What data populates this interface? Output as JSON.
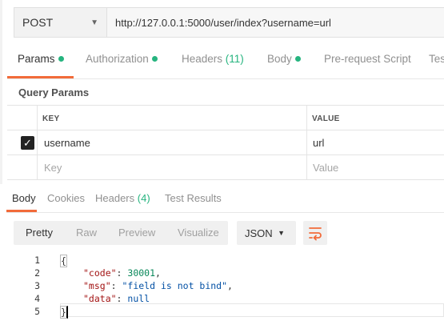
{
  "request": {
    "method": "POST",
    "url": "http://127.0.0.1:5000/user/index?username=url"
  },
  "request_tabs": [
    {
      "label": "Params",
      "dot": true
    },
    {
      "label": "Authorization",
      "dot": true
    },
    {
      "label": "Headers",
      "count": "(11)"
    },
    {
      "label": "Body",
      "dot": true
    },
    {
      "label": "Pre-request Script"
    },
    {
      "label": "Tes"
    }
  ],
  "query_params": {
    "title": "Query Params",
    "headers": {
      "key": "KEY",
      "value": "VALUE"
    },
    "rows": [
      {
        "key": "username",
        "value": "url",
        "checked": true
      }
    ],
    "placeholder_key": "Key",
    "placeholder_value": "Value"
  },
  "response_tabs": [
    {
      "label": "Body"
    },
    {
      "label": "Cookies"
    },
    {
      "label": "Headers",
      "count": "(4)"
    },
    {
      "label": "Test Results"
    }
  ],
  "view_modes": [
    "Pretty",
    "Raw",
    "Preview",
    "Visualize"
  ],
  "format": "JSON",
  "code": {
    "line_numbers": [
      "1",
      "2",
      "3",
      "4",
      "5"
    ],
    "open_brace": "{",
    "close_brace": "}",
    "lines": [
      {
        "key": "\"code\"",
        "sep": ": ",
        "value": "30001",
        "trail": ","
      },
      {
        "key": "\"msg\"",
        "sep": ": ",
        "value": "\"field is not bind\"",
        "trail": ","
      },
      {
        "key": "\"data\"",
        "sep": ": ",
        "value": "null",
        "trail": ""
      }
    ]
  },
  "colors": {
    "accent": "#f26b3a",
    "status_dot": "#26b47f"
  }
}
